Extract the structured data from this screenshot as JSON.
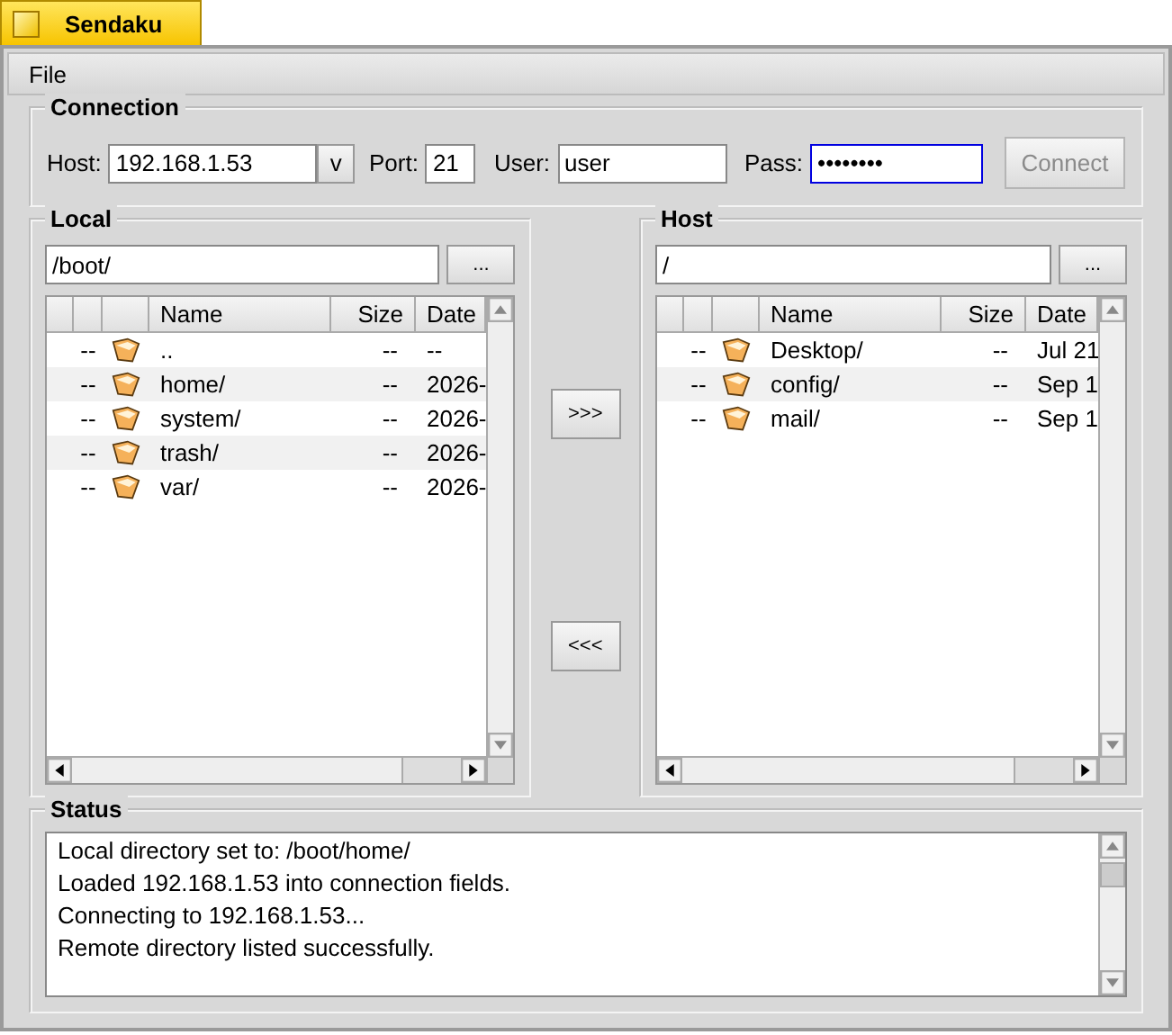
{
  "window": {
    "title": "Sendaku"
  },
  "menu": [
    "File"
  ],
  "connection": {
    "title": "Connection",
    "host_label": "Host:",
    "host": "192.168.1.53",
    "history_button": "v",
    "port_label": "Port:",
    "port": "21",
    "user_label": "User:",
    "user": "user",
    "pass_label": "Pass:",
    "pass": "••••••••",
    "pass_focused": true,
    "connect": {
      "label": "Connect",
      "disabled": true
    }
  },
  "panels": [
    {
      "title": "Local",
      "path": "/boot/",
      "browse": "...",
      "columns": [
        "Name",
        "Size",
        "Date"
      ],
      "rows": [
        {
          "flag": "--",
          "name": "..",
          "size": "--",
          "date": "--"
        },
        {
          "flag": "--",
          "name": "home/",
          "size": "--",
          "date": "2026-"
        },
        {
          "flag": "--",
          "name": "system/",
          "size": "--",
          "date": "2026-"
        },
        {
          "flag": "--",
          "name": "trash/",
          "size": "--",
          "date": "2026-"
        },
        {
          "flag": "--",
          "name": "var/",
          "size": "--",
          "date": "2026-"
        }
      ]
    },
    {
      "title": "Host",
      "path": "/",
      "browse": "...",
      "columns": [
        "Name",
        "Size",
        "Date"
      ],
      "rows": [
        {
          "flag": "--",
          "name": "Desktop/",
          "size": "--",
          "date": "Jul 21"
        },
        {
          "flag": "--",
          "name": "config/",
          "size": "--",
          "date": "Sep 1"
        },
        {
          "flag": "--",
          "name": "mail/",
          "size": "--",
          "date": "Sep 1"
        }
      ]
    }
  ],
  "transfer_buttons": [
    ">>>",
    "<<<"
  ],
  "status": {
    "title": "Status",
    "lines": [
      "Local directory set to: /boot/home/",
      "Loaded 192.168.1.53 into connection fields.",
      "Connecting to 192.168.1.53...",
      "Remote directory listed successfully."
    ]
  }
}
